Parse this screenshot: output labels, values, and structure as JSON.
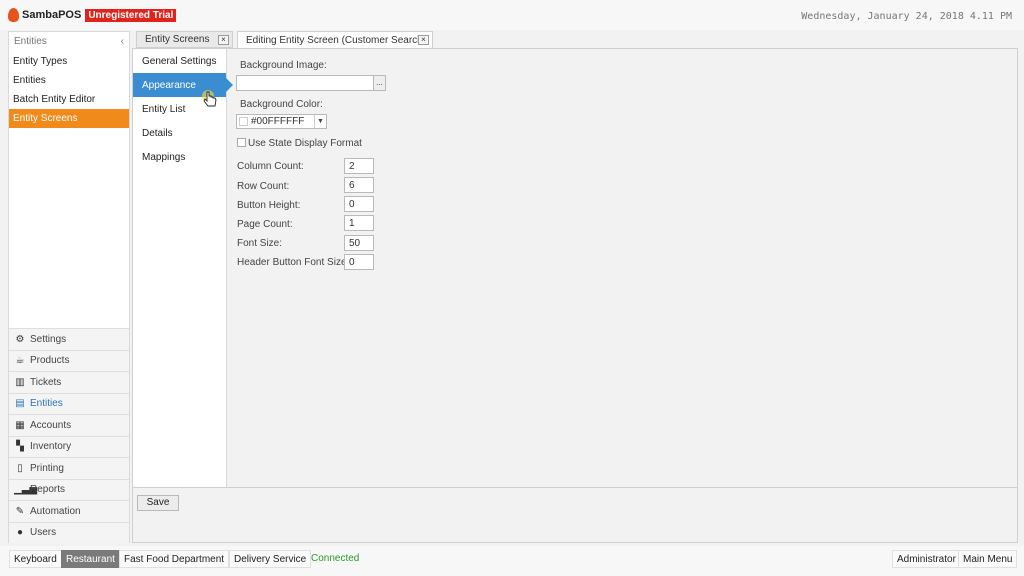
{
  "header": {
    "brand": "SambaPOS",
    "trial_badge": "Unregistered Trial",
    "datetime": "Wednesday, January 24, 2018 4.11 PM"
  },
  "left_panel": {
    "title": "Entities",
    "collapse_icon": "‹",
    "items": [
      {
        "label": "Entity Types"
      },
      {
        "label": "Entities"
      },
      {
        "label": "Batch Entity Editor"
      },
      {
        "label": "Entity Screens"
      }
    ],
    "active_index": 3
  },
  "nav": [
    {
      "label": "Settings",
      "icon": "gear-icon"
    },
    {
      "label": "Products",
      "icon": "coffee-icon"
    },
    {
      "label": "Tickets",
      "icon": "books-icon"
    },
    {
      "label": "Entities",
      "icon": "table-icon"
    },
    {
      "label": "Accounts",
      "icon": "calculator-icon"
    },
    {
      "label": "Inventory",
      "icon": "inventory-icon"
    },
    {
      "label": "Printing",
      "icon": "document-icon"
    },
    {
      "label": "Reports",
      "icon": "bar-chart-icon"
    },
    {
      "label": "Automation",
      "icon": "pen-icon"
    },
    {
      "label": "Users",
      "icon": "user-icon"
    }
  ],
  "tabs": [
    {
      "label": "Entity Screens",
      "close": "×"
    },
    {
      "label": "Editing Entity Screen (Customer Search)",
      "close": "×"
    }
  ],
  "settings_menu": [
    {
      "label": "General Settings"
    },
    {
      "label": "Appearance"
    },
    {
      "label": "Entity List"
    },
    {
      "label": "Details"
    },
    {
      "label": "Mappings"
    }
  ],
  "form": {
    "background_image_label": "Background Image:",
    "background_image_value": "",
    "browse_label": "...",
    "background_color_label": "Background Color:",
    "background_color_value": "#00FFFFFF",
    "use_state_display_format_label": "Use State Display Format",
    "use_state_display_format_checked": false,
    "fields": [
      {
        "label": "Column Count:",
        "value": "2"
      },
      {
        "label": "Row Count:",
        "value": "6"
      },
      {
        "label": "Button Height:",
        "value": "0"
      },
      {
        "label": "Page Count:",
        "value": "1"
      },
      {
        "label": "Font Size:",
        "value": "50"
      },
      {
        "label": "Header Button Font Size:",
        "value": "0"
      }
    ]
  },
  "save_label": "Save",
  "statusbar": {
    "keyboard": "Keyboard",
    "restaurant": "Restaurant",
    "department": "Fast Food Department",
    "delivery": "Delivery Service",
    "connected": "Connected",
    "user": "Administrator",
    "main_menu": "Main Menu"
  },
  "colors": {
    "accent_orange": "#f08a1b",
    "accent_blue": "#3a8dd0",
    "trial_red": "#e0231b",
    "connected_green": "#2b9a2b"
  }
}
